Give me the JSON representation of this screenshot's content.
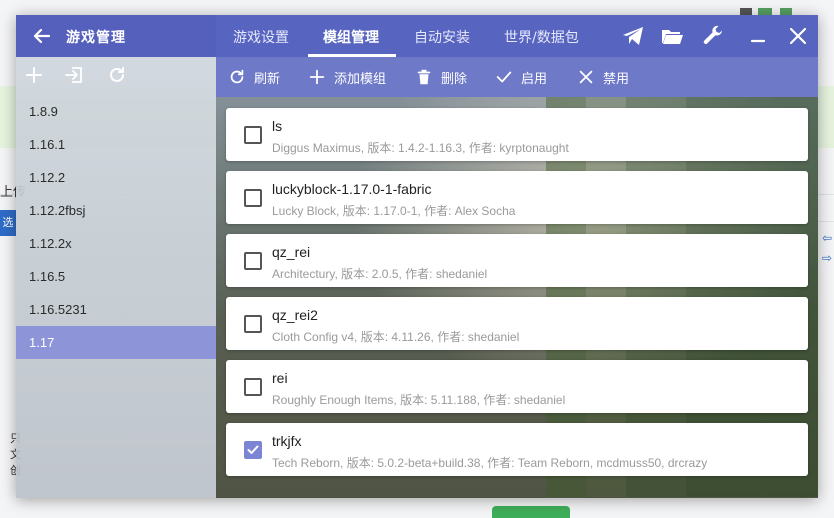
{
  "background": {
    "left_texts": [
      "上传",
      "选",
      "只",
      "文",
      "创"
    ]
  },
  "app": {
    "title": "游戏管理",
    "tabs": [
      {
        "label": "游戏设置",
        "active": false
      },
      {
        "label": "模组管理",
        "active": true
      },
      {
        "label": "自动安装",
        "active": false
      },
      {
        "label": "世界/数据包",
        "active": false
      }
    ],
    "title_icons": [
      "paper-plane-icon",
      "folder-open-icon",
      "wrench-icon",
      "minimize-icon",
      "close-icon"
    ],
    "accent": "#5765c1"
  },
  "sidebar": {
    "toolbar_icons": [
      "add-icon",
      "import-icon",
      "refresh-icon"
    ],
    "versions": [
      {
        "label": "1.8.9",
        "selected": false
      },
      {
        "label": "1.16.1",
        "selected": false
      },
      {
        "label": "1.12.2",
        "selected": false
      },
      {
        "label": "1.12.2fbsj",
        "selected": false
      },
      {
        "label": "1.12.2x",
        "selected": false
      },
      {
        "label": "1.16.5",
        "selected": false
      },
      {
        "label": "1.16.5231",
        "selected": false
      },
      {
        "label": "1.17",
        "selected": true
      }
    ]
  },
  "actions": [
    {
      "label": "刷新",
      "icon": "refresh-icon"
    },
    {
      "label": "添加模组",
      "icon": "plus-icon"
    },
    {
      "label": "删除",
      "icon": "trash-icon"
    },
    {
      "label": "启用",
      "icon": "check-icon"
    },
    {
      "label": "禁用",
      "icon": "close-icon"
    }
  ],
  "mods": [
    {
      "name": "ls",
      "desc": "Diggus Maximus, 版本: 1.4.2-1.16.3, 作者: kyrptonaught",
      "enabled": false
    },
    {
      "name": "luckyblock-1.17.0-1-fabric",
      "desc": "Lucky Block, 版本: 1.17.0-1, 作者: Alex Socha",
      "enabled": false
    },
    {
      "name": "qz_rei",
      "desc": "Architectury, 版本: 2.0.5, 作者: shedaniel",
      "enabled": false
    },
    {
      "name": "qz_rei2",
      "desc": "Cloth Config v4, 版本: 4.11.26, 作者: shedaniel",
      "enabled": false
    },
    {
      "name": "rei",
      "desc": "Roughly Enough Items, 版本: 5.11.188, 作者: shedaniel",
      "enabled": false
    },
    {
      "name": "trkjfx",
      "desc": "Tech Reborn, 版本: 5.0.2-beta+build.38, 作者: Team Reborn, mcdmuss50, drcrazy",
      "enabled": true
    }
  ]
}
